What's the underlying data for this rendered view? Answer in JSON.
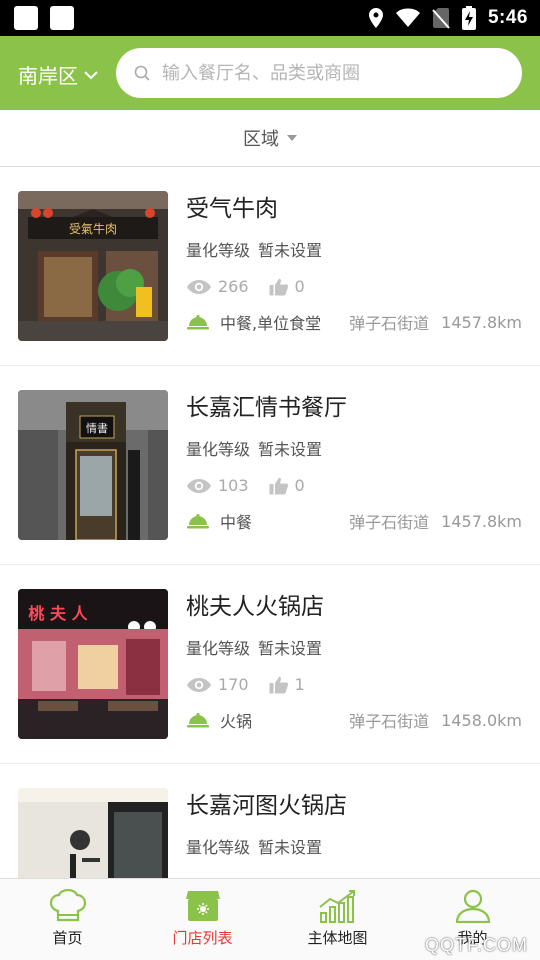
{
  "status_bar": {
    "time": "5:46"
  },
  "header": {
    "district": "南岸区",
    "search_placeholder": "输入餐厅名、品类或商圈"
  },
  "filter": {
    "region_label": "区域"
  },
  "restaurants": [
    {
      "name": "受气牛肉",
      "level_label": "量化等级",
      "level_value": "暂未设置",
      "views": "266",
      "likes": "0",
      "category": "中餐,单位食堂",
      "street": "弹子石街道",
      "distance": "1457.8km"
    },
    {
      "name": "长嘉汇情书餐厅",
      "level_label": "量化等级",
      "level_value": "暂未设置",
      "views": "103",
      "likes": "0",
      "category": "中餐",
      "street": "弹子石街道",
      "distance": "1457.8km"
    },
    {
      "name": "桃夫人火锅店",
      "level_label": "量化等级",
      "level_value": "暂未设置",
      "views": "170",
      "likes": "1",
      "category": "火锅",
      "street": "弹子石街道",
      "distance": "1458.0km"
    },
    {
      "name": "长嘉河图火锅店",
      "level_label": "量化等级",
      "level_value": "暂未设置",
      "views": "",
      "likes": "",
      "category": "",
      "street": "",
      "distance": ""
    }
  ],
  "photo_signs": [
    "受氣牛肉",
    "情書",
    "桃 夫 人"
  ],
  "bottom_nav": {
    "tabs": [
      {
        "label": "首页",
        "icon": "chef-hat-icon"
      },
      {
        "label": "门店列表",
        "icon": "store-icon"
      },
      {
        "label": "主体地图",
        "icon": "bar-chart-icon"
      },
      {
        "label": "我的",
        "icon": "user-icon"
      }
    ],
    "active_index": 1
  },
  "watermark": "QQTF.COM",
  "colors": {
    "brand_green": "#8bc34a",
    "active_red": "#e53935",
    "icon_green": "#8bc34a"
  }
}
